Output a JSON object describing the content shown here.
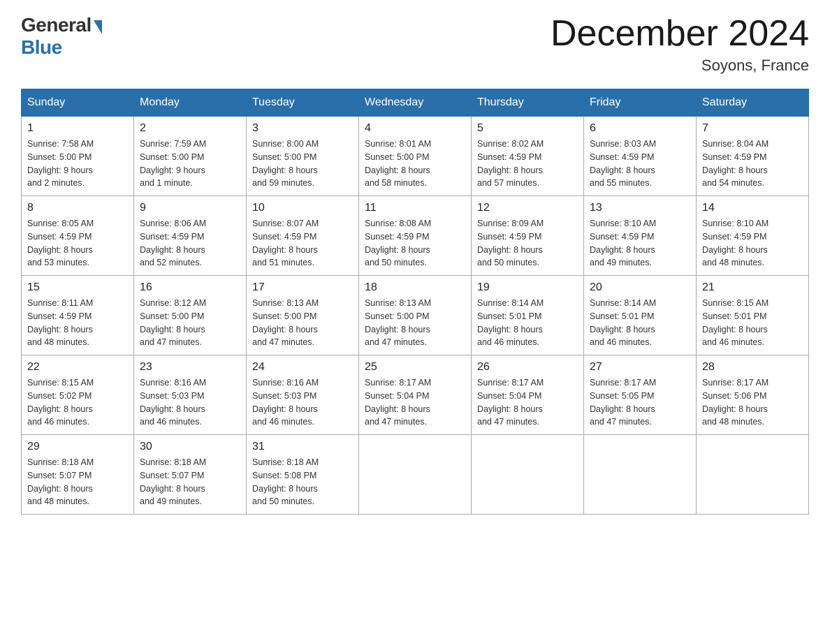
{
  "logo": {
    "general": "General",
    "blue": "Blue"
  },
  "title": "December 2024",
  "location": "Soyons, France",
  "days_of_week": [
    "Sunday",
    "Monday",
    "Tuesday",
    "Wednesday",
    "Thursday",
    "Friday",
    "Saturday"
  ],
  "weeks": [
    [
      {
        "day": "1",
        "sunrise": "7:58 AM",
        "sunset": "5:00 PM",
        "daylight": "9 hours and 2 minutes."
      },
      {
        "day": "2",
        "sunrise": "7:59 AM",
        "sunset": "5:00 PM",
        "daylight": "9 hours and 1 minute."
      },
      {
        "day": "3",
        "sunrise": "8:00 AM",
        "sunset": "5:00 PM",
        "daylight": "8 hours and 59 minutes."
      },
      {
        "day": "4",
        "sunrise": "8:01 AM",
        "sunset": "5:00 PM",
        "daylight": "8 hours and 58 minutes."
      },
      {
        "day": "5",
        "sunrise": "8:02 AM",
        "sunset": "4:59 PM",
        "daylight": "8 hours and 57 minutes."
      },
      {
        "day": "6",
        "sunrise": "8:03 AM",
        "sunset": "4:59 PM",
        "daylight": "8 hours and 55 minutes."
      },
      {
        "day": "7",
        "sunrise": "8:04 AM",
        "sunset": "4:59 PM",
        "daylight": "8 hours and 54 minutes."
      }
    ],
    [
      {
        "day": "8",
        "sunrise": "8:05 AM",
        "sunset": "4:59 PM",
        "daylight": "8 hours and 53 minutes."
      },
      {
        "day": "9",
        "sunrise": "8:06 AM",
        "sunset": "4:59 PM",
        "daylight": "8 hours and 52 minutes."
      },
      {
        "day": "10",
        "sunrise": "8:07 AM",
        "sunset": "4:59 PM",
        "daylight": "8 hours and 51 minutes."
      },
      {
        "day": "11",
        "sunrise": "8:08 AM",
        "sunset": "4:59 PM",
        "daylight": "8 hours and 50 minutes."
      },
      {
        "day": "12",
        "sunrise": "8:09 AM",
        "sunset": "4:59 PM",
        "daylight": "8 hours and 50 minutes."
      },
      {
        "day": "13",
        "sunrise": "8:10 AM",
        "sunset": "4:59 PM",
        "daylight": "8 hours and 49 minutes."
      },
      {
        "day": "14",
        "sunrise": "8:10 AM",
        "sunset": "4:59 PM",
        "daylight": "8 hours and 48 minutes."
      }
    ],
    [
      {
        "day": "15",
        "sunrise": "8:11 AM",
        "sunset": "4:59 PM",
        "daylight": "8 hours and 48 minutes."
      },
      {
        "day": "16",
        "sunrise": "8:12 AM",
        "sunset": "5:00 PM",
        "daylight": "8 hours and 47 minutes."
      },
      {
        "day": "17",
        "sunrise": "8:13 AM",
        "sunset": "5:00 PM",
        "daylight": "8 hours and 47 minutes."
      },
      {
        "day": "18",
        "sunrise": "8:13 AM",
        "sunset": "5:00 PM",
        "daylight": "8 hours and 47 minutes."
      },
      {
        "day": "19",
        "sunrise": "8:14 AM",
        "sunset": "5:01 PM",
        "daylight": "8 hours and 46 minutes."
      },
      {
        "day": "20",
        "sunrise": "8:14 AM",
        "sunset": "5:01 PM",
        "daylight": "8 hours and 46 minutes."
      },
      {
        "day": "21",
        "sunrise": "8:15 AM",
        "sunset": "5:01 PM",
        "daylight": "8 hours and 46 minutes."
      }
    ],
    [
      {
        "day": "22",
        "sunrise": "8:15 AM",
        "sunset": "5:02 PM",
        "daylight": "8 hours and 46 minutes."
      },
      {
        "day": "23",
        "sunrise": "8:16 AM",
        "sunset": "5:03 PM",
        "daylight": "8 hours and 46 minutes."
      },
      {
        "day": "24",
        "sunrise": "8:16 AM",
        "sunset": "5:03 PM",
        "daylight": "8 hours and 46 minutes."
      },
      {
        "day": "25",
        "sunrise": "8:17 AM",
        "sunset": "5:04 PM",
        "daylight": "8 hours and 47 minutes."
      },
      {
        "day": "26",
        "sunrise": "8:17 AM",
        "sunset": "5:04 PM",
        "daylight": "8 hours and 47 minutes."
      },
      {
        "day": "27",
        "sunrise": "8:17 AM",
        "sunset": "5:05 PM",
        "daylight": "8 hours and 47 minutes."
      },
      {
        "day": "28",
        "sunrise": "8:17 AM",
        "sunset": "5:06 PM",
        "daylight": "8 hours and 48 minutes."
      }
    ],
    [
      {
        "day": "29",
        "sunrise": "8:18 AM",
        "sunset": "5:07 PM",
        "daylight": "8 hours and 48 minutes."
      },
      {
        "day": "30",
        "sunrise": "8:18 AM",
        "sunset": "5:07 PM",
        "daylight": "8 hours and 49 minutes."
      },
      {
        "day": "31",
        "sunrise": "8:18 AM",
        "sunset": "5:08 PM",
        "daylight": "8 hours and 50 minutes."
      },
      null,
      null,
      null,
      null
    ]
  ]
}
